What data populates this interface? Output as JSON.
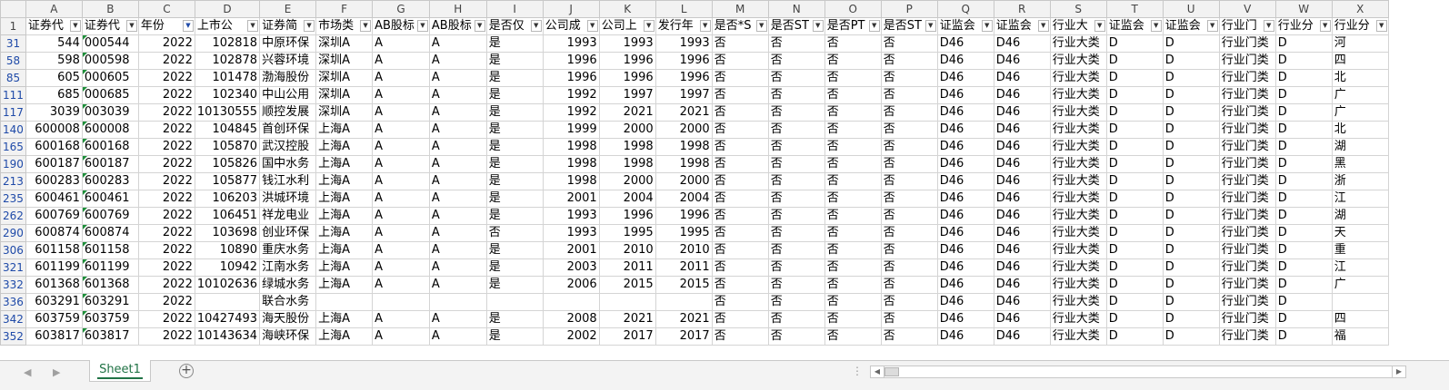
{
  "columns": [
    "A",
    "B",
    "C",
    "D",
    "E",
    "F",
    "G",
    "H",
    "I",
    "J",
    "K",
    "L",
    "M",
    "N",
    "O",
    "P",
    "Q",
    "R",
    "S",
    "T",
    "U",
    "V",
    "W",
    "X"
  ],
  "header_row": {
    "row_number": "1",
    "cells": [
      "证券代",
      "证券代",
      "年份",
      "上市公",
      "证券简",
      "市场类",
      "AB股标",
      "AB股标",
      "是否仅",
      "公司成",
      "公司上",
      "发行年",
      "是否*S",
      "是否ST",
      "是否PT",
      "是否ST",
      "证监会",
      "证监会",
      "行业大",
      "证监会",
      "证监会",
      "行业门",
      "行业分",
      "行业分"
    ],
    "filter_active_column": "C"
  },
  "rows": [
    {
      "rn": "31",
      "cells": [
        "544",
        "000544",
        "2022",
        "102818",
        "中原环保",
        "深圳A",
        "A",
        "A",
        "是",
        "1993",
        "1993",
        "1993",
        "否",
        "否",
        "否",
        "否",
        "D46",
        "D46",
        "行业大类",
        "D",
        "D",
        "行业门类",
        "D",
        "河"
      ]
    },
    {
      "rn": "58",
      "cells": [
        "598",
        "000598",
        "2022",
        "102878",
        "兴蓉环境",
        "深圳A",
        "A",
        "A",
        "是",
        "1996",
        "1996",
        "1996",
        "否",
        "否",
        "否",
        "否",
        "D46",
        "D46",
        "行业大类",
        "D",
        "D",
        "行业门类",
        "D",
        "四"
      ]
    },
    {
      "rn": "85",
      "cells": [
        "605",
        "000605",
        "2022",
        "101478",
        "渤海股份",
        "深圳A",
        "A",
        "A",
        "是",
        "1996",
        "1996",
        "1996",
        "否",
        "否",
        "否",
        "否",
        "D46",
        "D46",
        "行业大类",
        "D",
        "D",
        "行业门类",
        "D",
        "北"
      ]
    },
    {
      "rn": "111",
      "cells": [
        "685",
        "000685",
        "2022",
        "102340",
        "中山公用",
        "深圳A",
        "A",
        "A",
        "是",
        "1992",
        "1997",
        "1997",
        "否",
        "否",
        "否",
        "否",
        "D46",
        "D46",
        "行业大类",
        "D",
        "D",
        "行业门类",
        "D",
        "广"
      ]
    },
    {
      "rn": "117",
      "cells": [
        "3039",
        "003039",
        "2022",
        "10130555",
        "顺控发展",
        "深圳A",
        "A",
        "A",
        "是",
        "1992",
        "2021",
        "2021",
        "否",
        "否",
        "否",
        "否",
        "D46",
        "D46",
        "行业大类",
        "D",
        "D",
        "行业门类",
        "D",
        "广"
      ]
    },
    {
      "rn": "140",
      "cells": [
        "600008",
        "600008",
        "2022",
        "104845",
        "首创环保",
        "上海A",
        "A",
        "A",
        "是",
        "1999",
        "2000",
        "2000",
        "否",
        "否",
        "否",
        "否",
        "D46",
        "D46",
        "行业大类",
        "D",
        "D",
        "行业门类",
        "D",
        "北"
      ]
    },
    {
      "rn": "165",
      "cells": [
        "600168",
        "600168",
        "2022",
        "105870",
        "武汉控股",
        "上海A",
        "A",
        "A",
        "是",
        "1998",
        "1998",
        "1998",
        "否",
        "否",
        "否",
        "否",
        "D46",
        "D46",
        "行业大类",
        "D",
        "D",
        "行业门类",
        "D",
        "湖"
      ]
    },
    {
      "rn": "190",
      "cells": [
        "600187",
        "600187",
        "2022",
        "105826",
        "国中水务",
        "上海A",
        "A",
        "A",
        "是",
        "1998",
        "1998",
        "1998",
        "否",
        "否",
        "否",
        "否",
        "D46",
        "D46",
        "行业大类",
        "D",
        "D",
        "行业门类",
        "D",
        "黑"
      ]
    },
    {
      "rn": "213",
      "cells": [
        "600283",
        "600283",
        "2022",
        "105877",
        "钱江水利",
        "上海A",
        "A",
        "A",
        "是",
        "1998",
        "2000",
        "2000",
        "否",
        "否",
        "否",
        "否",
        "D46",
        "D46",
        "行业大类",
        "D",
        "D",
        "行业门类",
        "D",
        "浙"
      ]
    },
    {
      "rn": "235",
      "cells": [
        "600461",
        "600461",
        "2022",
        "106203",
        "洪城环境",
        "上海A",
        "A",
        "A",
        "是",
        "2001",
        "2004",
        "2004",
        "否",
        "否",
        "否",
        "否",
        "D46",
        "D46",
        "行业大类",
        "D",
        "D",
        "行业门类",
        "D",
        "江"
      ]
    },
    {
      "rn": "262",
      "cells": [
        "600769",
        "600769",
        "2022",
        "106451",
        "祥龙电业",
        "上海A",
        "A",
        "A",
        "是",
        "1993",
        "1996",
        "1996",
        "否",
        "否",
        "否",
        "否",
        "D46",
        "D46",
        "行业大类",
        "D",
        "D",
        "行业门类",
        "D",
        "湖"
      ]
    },
    {
      "rn": "290",
      "cells": [
        "600874",
        "600874",
        "2022",
        "103698",
        "创业环保",
        "上海A",
        "A",
        "A",
        "否",
        "1993",
        "1995",
        "1995",
        "否",
        "否",
        "否",
        "否",
        "D46",
        "D46",
        "行业大类",
        "D",
        "D",
        "行业门类",
        "D",
        "天"
      ]
    },
    {
      "rn": "306",
      "cells": [
        "601158",
        "601158",
        "2022",
        "10890",
        "重庆水务",
        "上海A",
        "A",
        "A",
        "是",
        "2001",
        "2010",
        "2010",
        "否",
        "否",
        "否",
        "否",
        "D46",
        "D46",
        "行业大类",
        "D",
        "D",
        "行业门类",
        "D",
        "重"
      ]
    },
    {
      "rn": "321",
      "cells": [
        "601199",
        "601199",
        "2022",
        "10942",
        "江南水务",
        "上海A",
        "A",
        "A",
        "是",
        "2003",
        "2011",
        "2011",
        "否",
        "否",
        "否",
        "否",
        "D46",
        "D46",
        "行业大类",
        "D",
        "D",
        "行业门类",
        "D",
        "江"
      ]
    },
    {
      "rn": "332",
      "cells": [
        "601368",
        "601368",
        "2022",
        "10102636",
        "绿城水务",
        "上海A",
        "A",
        "A",
        "是",
        "2006",
        "2015",
        "2015",
        "否",
        "否",
        "否",
        "否",
        "D46",
        "D46",
        "行业大类",
        "D",
        "D",
        "行业门类",
        "D",
        "广"
      ]
    },
    {
      "rn": "336",
      "cells": [
        "603291",
        "603291",
        "2022",
        "",
        "联合水务",
        "",
        "",
        "",
        "",
        "",
        "",
        "",
        "否",
        "否",
        "否",
        "否",
        "D46",
        "D46",
        "行业大类",
        "D",
        "D",
        "行业门类",
        "D",
        ""
      ]
    },
    {
      "rn": "342",
      "cells": [
        "603759",
        "603759",
        "2022",
        "10427493",
        "海天股份",
        "上海A",
        "A",
        "A",
        "是",
        "2008",
        "2021",
        "2021",
        "否",
        "否",
        "否",
        "否",
        "D46",
        "D46",
        "行业大类",
        "D",
        "D",
        "行业门类",
        "D",
        "四"
      ]
    },
    {
      "rn": "352",
      "cells": [
        "603817",
        "603817",
        "2022",
        "10143634",
        "海峡环保",
        "上海A",
        "A",
        "A",
        "是",
        "2002",
        "2017",
        "2017",
        "否",
        "否",
        "否",
        "否",
        "D46",
        "D46",
        "行业大类",
        "D",
        "D",
        "行业门类",
        "D",
        "福"
      ]
    }
  ],
  "numeric_columns": [
    0,
    2,
    3,
    9,
    10,
    11
  ],
  "text_number_column": 1,
  "sheet_tab": "Sheet1",
  "add_sheet_icon": "plus-circle-icon",
  "scroll_dots": "⋮",
  "colors": {
    "accent": "#217346",
    "row_number": "#1f4aa8",
    "error_triangle": "#1e8f3a"
  }
}
